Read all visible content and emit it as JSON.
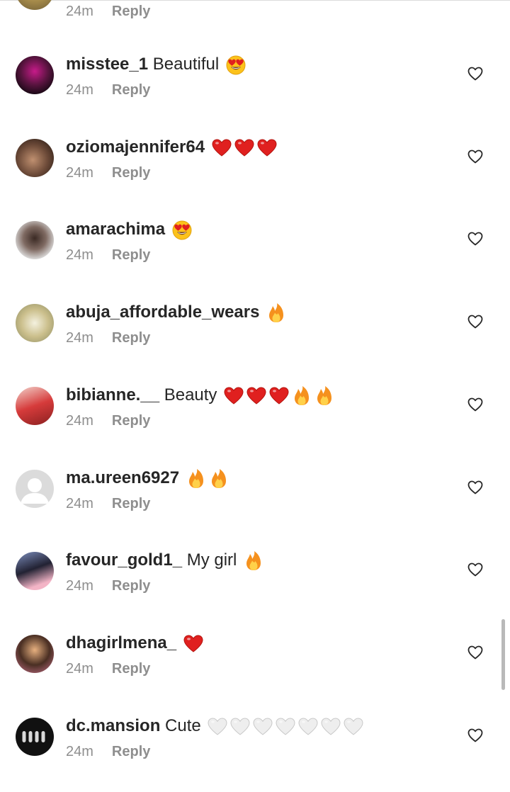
{
  "top_partial": {
    "time": "24m",
    "reply": "Reply"
  },
  "comments": [
    {
      "user": "misstee_1",
      "text": "Beautiful",
      "emojis": [
        "heart-eyes"
      ],
      "time": "24m",
      "reply": "Reply",
      "avatar": "photo"
    },
    {
      "user": "oziomajennifer64",
      "text": "",
      "emojis": [
        "red-heart",
        "red-heart",
        "red-heart"
      ],
      "time": "24m",
      "reply": "Reply",
      "avatar": "photo"
    },
    {
      "user": "amarachima",
      "text": "",
      "emojis": [
        "heart-eyes"
      ],
      "time": "24m",
      "reply": "Reply",
      "avatar": "photo"
    },
    {
      "user": "abuja_affordable_wears",
      "text": "",
      "emojis": [
        "fire"
      ],
      "time": "24m",
      "reply": "Reply",
      "avatar": "photo"
    },
    {
      "user": "bibianne.__",
      "text": "Beauty",
      "emojis": [
        "red-heart",
        "red-heart",
        "red-heart",
        "fire",
        "fire"
      ],
      "time": "24m",
      "reply": "Reply",
      "avatar": "photo"
    },
    {
      "user": "ma.ureen6927",
      "text": "",
      "emojis": [
        "fire",
        "fire"
      ],
      "time": "24m",
      "reply": "Reply",
      "avatar": "default"
    },
    {
      "user": "favour_gold1_",
      "text": "My girl",
      "emojis": [
        "fire"
      ],
      "time": "24m",
      "reply": "Reply",
      "avatar": "photo"
    },
    {
      "user": "dhagirlmena_",
      "text": "",
      "emojis": [
        "red-heart"
      ],
      "time": "24m",
      "reply": "Reply",
      "avatar": "photo"
    },
    {
      "user": "dc.mansion",
      "text": "Cute",
      "emojis": [
        "white-heart",
        "white-heart",
        "white-heart",
        "white-heart",
        "white-heart",
        "white-heart",
        "white-heart"
      ],
      "time": "24m",
      "reply": "Reply",
      "avatar": "logo"
    }
  ],
  "colors": {
    "username": "#262626",
    "meta": "#8e8e8e",
    "heart_red": "#e0201f",
    "fire": "#f5911e"
  },
  "icons": {
    "like": "heart-outline-icon"
  }
}
